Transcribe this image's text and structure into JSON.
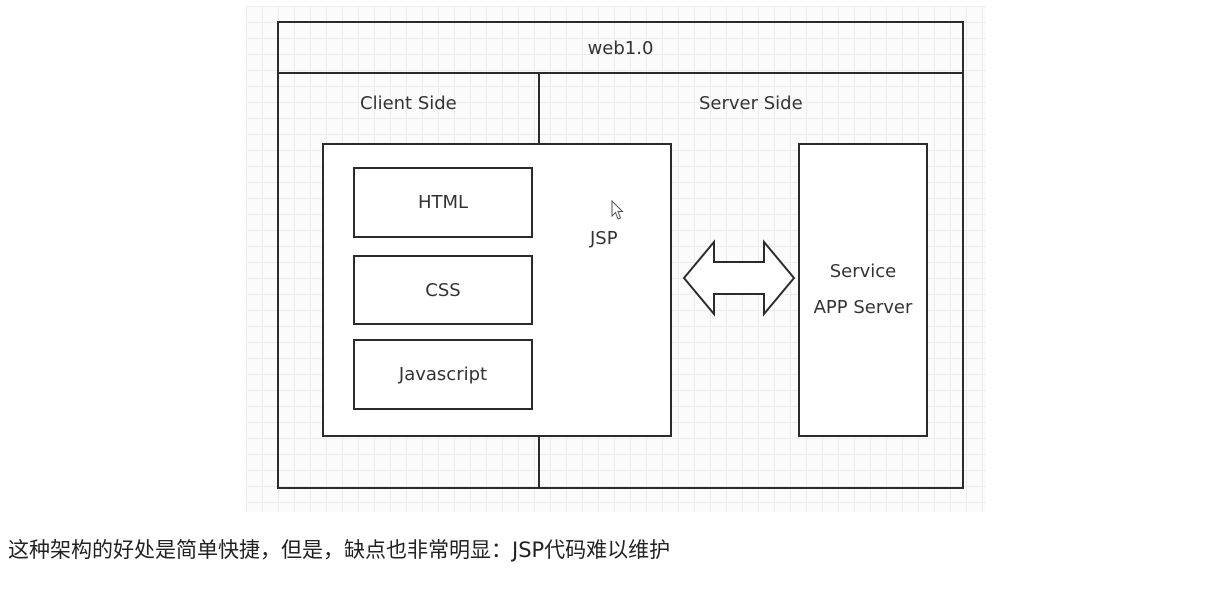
{
  "diagram": {
    "title": "web1.0",
    "client_label": "Client Side",
    "server_label": "Server Side",
    "client_boxes": [
      "HTML",
      "CSS",
      "Javascript"
    ],
    "jsp_label": "JSP",
    "server_box": {
      "line1": "Service",
      "line2": "APP Server"
    },
    "arrow_icon": "double-arrow-icon"
  },
  "caption": "这种架构的好处是简单快捷，但是，缺点也非常明显：JSP代码难以维护"
}
